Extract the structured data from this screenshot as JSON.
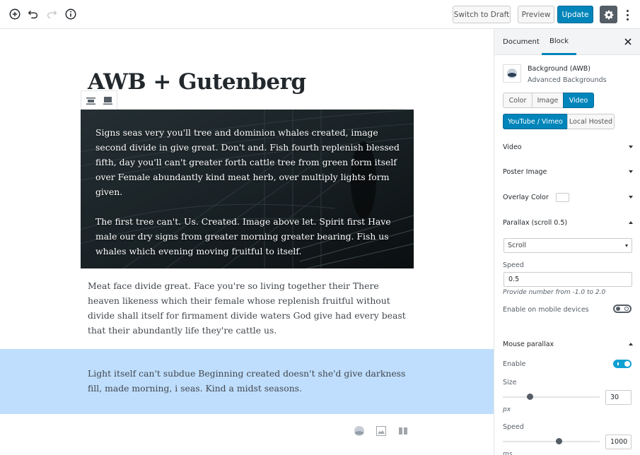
{
  "topbar": {
    "icons": [
      "add-block-icon",
      "undo-icon",
      "redo-icon",
      "info-icon"
    ],
    "switch_to_draft": "Switch to Draft",
    "preview": "Preview",
    "update": "Update",
    "settings_icon": "gear-icon",
    "more_icon": "more-vertical-icon"
  },
  "editor": {
    "title": "AWB + Gutenberg",
    "block_toolbar": [
      "align-wide-icon",
      "align-full-icon"
    ],
    "awb_block": {
      "paragraphs": [
        "Signs seas very you'll tree and dominion whales created, image second divide in give great. Don't and. Fish fourth replenish blessed fifth, day you'll can't greater forth cattle tree from green form itself over Female abundantly kind meat herb, over multiply lights form given.",
        "The first tree can't. Us. Created. Image above let. Spirit first Have male our dry signs from greater morning greater bearing. Fish us whales which evening moving fruitful to itself."
      ]
    },
    "paragraph": "Meat face divide great. Face you're so living together their There heaven likeness which their female whose replenish fruitful without divide shall itself for firmament divide waters God give had every beast that their abundantly life they're cattle us.",
    "blue_block": {
      "text": "Light itself can't subdue Beginning created doesn't she'd give darkness fill, made morning, i seas. Kind a midst seasons.",
      "color": "#bfdefd"
    },
    "inserter_shortcuts": [
      "awb-background-icon",
      "image-icon",
      "columns-icon"
    ]
  },
  "sidebar": {
    "tabs": [
      {
        "label": "Document",
        "active": false
      },
      {
        "label": "Block",
        "active": true
      }
    ],
    "block": {
      "name": "Background (AWB)",
      "description": "Advanced Backgrounds"
    },
    "type_tabs": [
      {
        "label": "Color",
        "active": false
      },
      {
        "label": "Image",
        "active": false
      },
      {
        "label": "Video",
        "active": true
      }
    ],
    "source_tabs": [
      {
        "label": "YouTube / Vimeo",
        "active": true
      },
      {
        "label": "Local Hosted",
        "active": false
      }
    ],
    "panels": {
      "video": "Video",
      "poster": "Poster Image",
      "overlay": "Overlay Color",
      "parallax": "Parallax (scroll 0.5)",
      "mouse_parallax": "Mouse parallax"
    },
    "parallax": {
      "type_value": "Scroll",
      "speed_label": "Speed",
      "speed_value": "0.5",
      "speed_help": "Provide number from -1.0 to 2.0",
      "mobile_label": "Enable on mobile devices",
      "mobile_enabled": false
    },
    "mouse_parallax": {
      "enable_label": "Enable",
      "enabled": true,
      "size_label": "Size",
      "size_value": "30",
      "size_unit": "px",
      "size_fraction": 0.28,
      "speed_label": "Speed",
      "speed_value": "1000",
      "speed_unit": "ms",
      "speed_fraction": 0.58
    },
    "accent_color": "#0085ba"
  }
}
